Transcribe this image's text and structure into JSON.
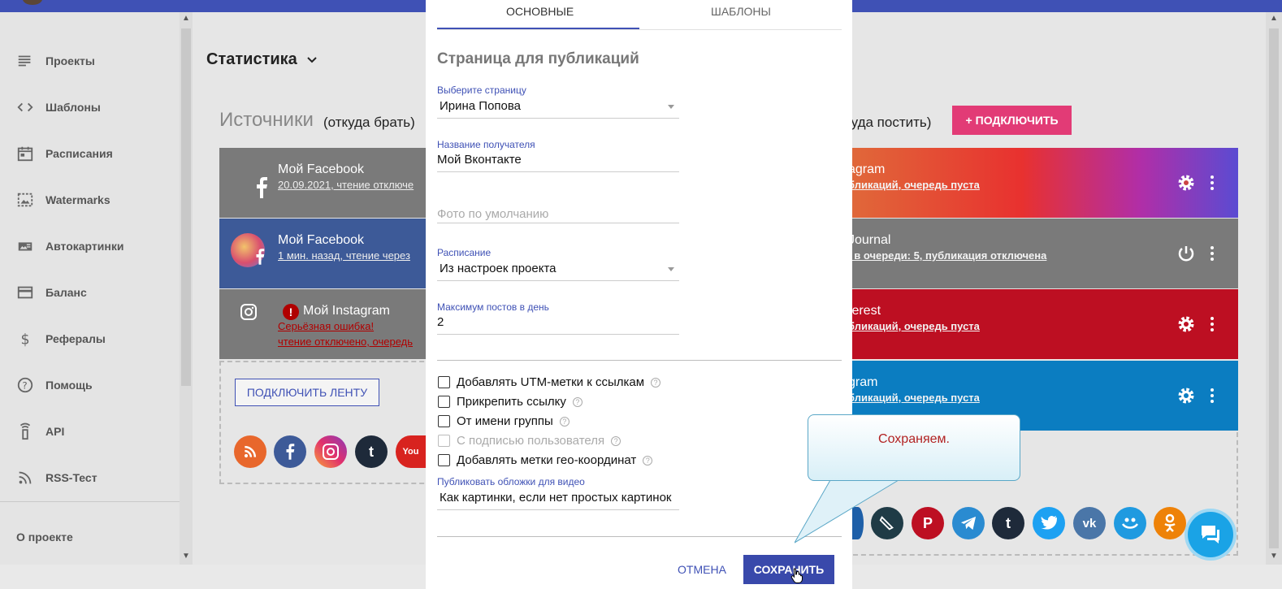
{
  "sidebar": {
    "items": [
      {
        "label": "Проекты",
        "icon": "list-icon"
      },
      {
        "label": "Шаблоны",
        "icon": "code-icon"
      },
      {
        "label": "Расписания",
        "icon": "calendar-icon"
      },
      {
        "label": "Watermarks",
        "icon": "image-icon"
      },
      {
        "label": "Автокартинки",
        "icon": "picture-card-icon"
      },
      {
        "label": "Баланс",
        "icon": "credit-card-icon"
      },
      {
        "label": "Рефералы",
        "icon": "dollar-icon"
      },
      {
        "label": "Помощь",
        "icon": "help-circle-icon"
      },
      {
        "label": "API",
        "icon": "antenna-icon"
      },
      {
        "label": "RSS-Тест",
        "icon": "rss-icon"
      }
    ],
    "about": "О проекте"
  },
  "main": {
    "stat_title": "Статистика",
    "sources_title": "Источники",
    "sources_sub": "(откуда брать)",
    "dest_sub": "куда постить)",
    "connect_label": "ПОДКЛЮЧИТЬ",
    "feed_button": "ПОДКЛЮЧИТЬ ЛЕНТУ",
    "sources": [
      {
        "title": "Мой Facebook",
        "status": "20.09.2021, чтение отключе"
      },
      {
        "title": "Мой Facebook",
        "status": "1 мин. назад, чтение через"
      },
      {
        "title": "Мой Instagram",
        "error": "Серьёзная ошибка!",
        "status": "чтение отключено, очередь"
      }
    ],
    "destinations": [
      {
        "title": "agram",
        "status": "бликаций, очередь пуста"
      },
      {
        "title": "Journal",
        "status": ", в очереди: 5, публикация отключена"
      },
      {
        "title": "terest",
        "status": "бликаций, очередь пуста"
      },
      {
        "title": "gram",
        "status": "бликаций, очередь пуста"
      }
    ]
  },
  "modal": {
    "tabs": [
      "ОСНОВНЫЕ",
      "ШАБЛОНЫ"
    ],
    "title": "Страница для публикаций",
    "page_label": "Выберите страницу",
    "page_value": "Ирина Попова",
    "recipient_label": "Название получателя",
    "recipient_value": "Мой Вконтакте",
    "photo_placeholder": "Фото по умолчанию",
    "schedule_label": "Расписание",
    "schedule_value": "Из настроек проекта",
    "max_label": "Максимум постов в день",
    "max_value": "2",
    "checkboxes": [
      "Добавлять UTM-метки к ссылкам",
      "Прикрепить ссылку",
      "От имени группы",
      "С подписью пользователя",
      "Добавлять метки гео-координат"
    ],
    "video_label": "Публиковать обложки для видео",
    "video_value": "Как картинки, если нет простых картинок",
    "cancel": "ОТМЕНА",
    "save": "СОХРАНИТЬ"
  },
  "callout": {
    "text": "Сохраняем."
  },
  "colors": {
    "primary": "#3f51b5",
    "accent": "#e23b76",
    "facebook": "#3d5a98",
    "pinterest": "#bd0f22",
    "telegram": "#0b7dc1"
  }
}
